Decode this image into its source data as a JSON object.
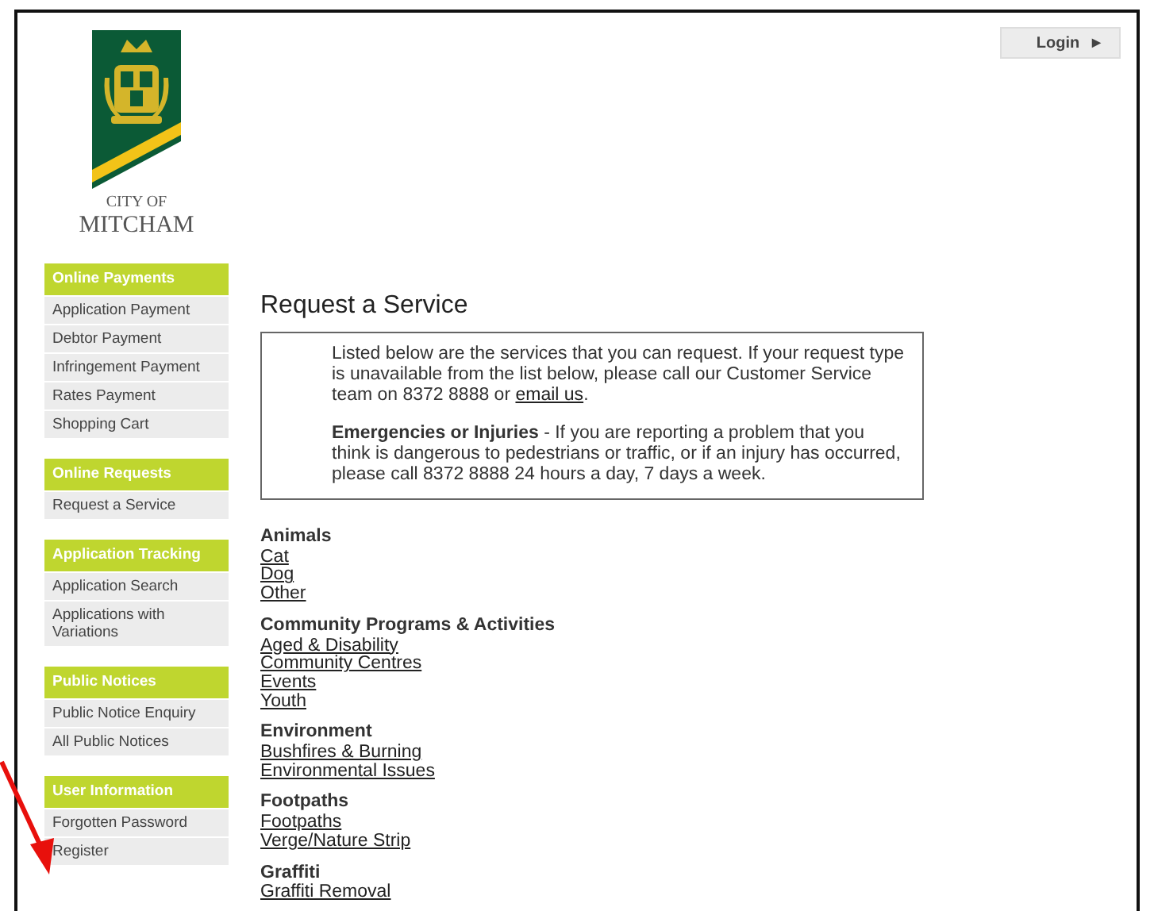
{
  "header": {
    "logo": {
      "line_1": "CITY OF",
      "line_2": "MITCHAM"
    },
    "login_button": {
      "label": "Login",
      "icon": "▶"
    }
  },
  "sidebar": {
    "sections": [
      {
        "title": "Online Payments",
        "items": [
          "Application Payment",
          "Debtor Payment",
          "Infringement Payment",
          "Rates Payment",
          "Shopping Cart"
        ]
      },
      {
        "title": "Online Requests",
        "items": [
          "Request a Service"
        ]
      },
      {
        "title": "Application Tracking",
        "items": [
          "Application Search",
          "Applications with Variations"
        ]
      },
      {
        "title": "Public Notices",
        "items": [
          "Public Notice Enquiry",
          "All Public Notices"
        ]
      },
      {
        "title": "User Information",
        "items": [
          "Forgotten Password",
          "Register"
        ]
      }
    ]
  },
  "main": {
    "title": "Request a Service",
    "intro": {
      "paragraph_1": {
        "text": "Listed below are the services that you can request. If your request type is unavailable from the list below, please call our Customer Service team on 8372 8888 or ",
        "link": "email us",
        "after": "."
      },
      "paragraph_2": "**Emergencies or Injuries** - If you are reporting a problem that you think is dangerous to pedestrians or traffic, or if an injury has occurred, please call 8372 8888 24 hours a day, 7 days a week."
    },
    "categories": [
      {
        "title": "Animals",
        "links": [
          "Cat",
          "Dog",
          "Other"
        ]
      },
      {
        "title": "Community Programs & Activities",
        "links": [
          "Aged & Disability",
          "Community Centres",
          "Events",
          "Youth"
        ]
      },
      {
        "title": "Environment",
        "links": [
          "Bushfires & Burning",
          "Environmental Issues"
        ]
      },
      {
        "title": "Footpaths",
        "links": [
          "Footpaths",
          "Verge/Nature Strip"
        ]
      },
      {
        "title": "Graffiti",
        "links": [
          "Graffiti Removal"
        ]
      }
    ]
  }
}
